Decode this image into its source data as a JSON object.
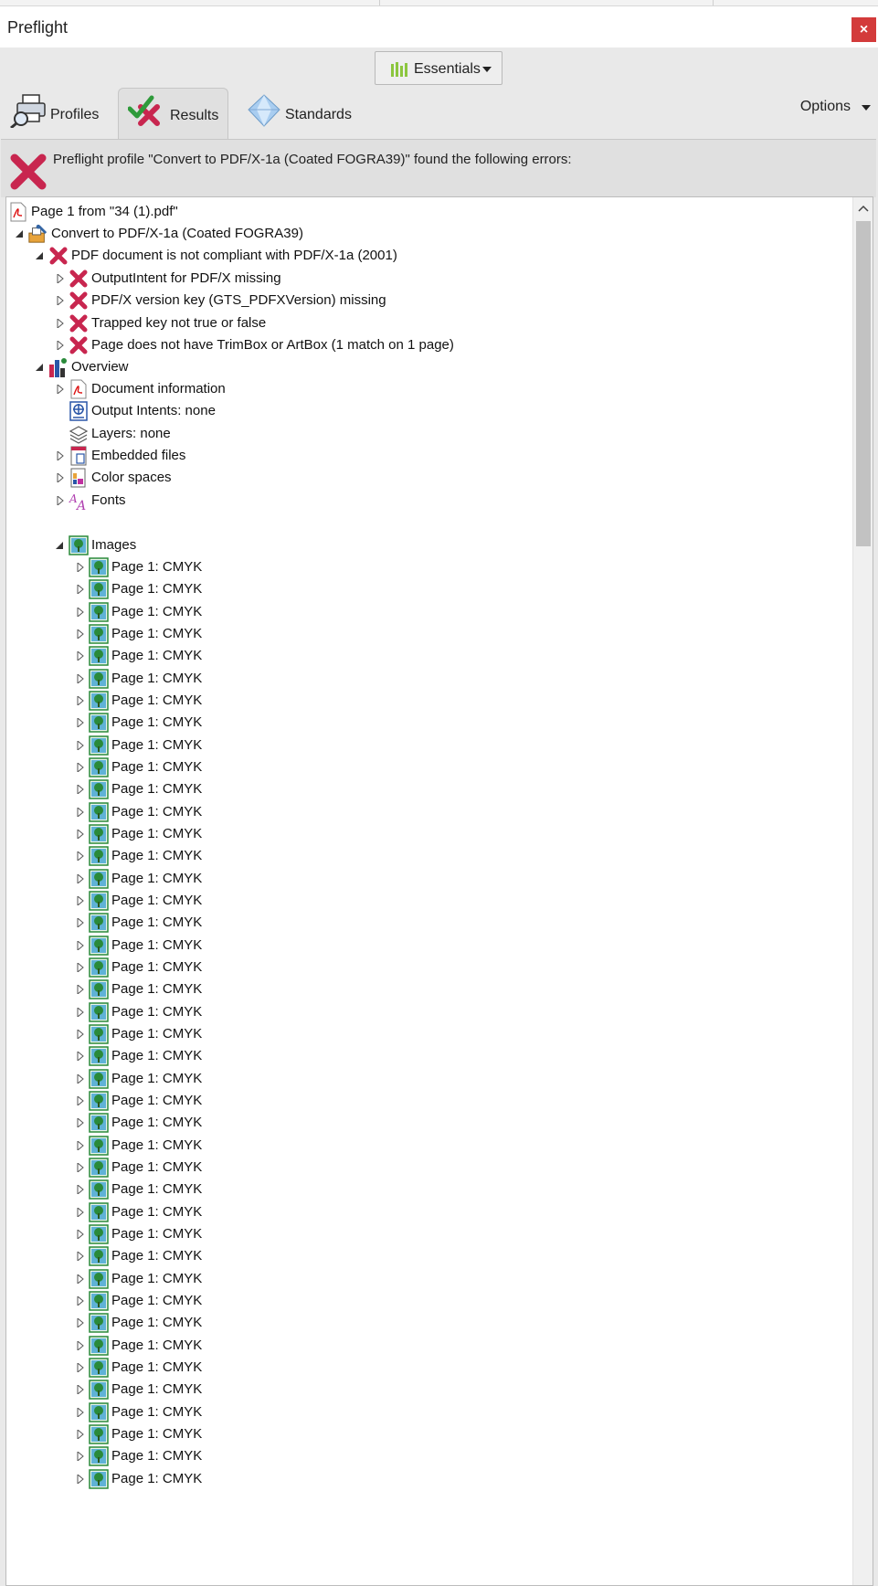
{
  "window": {
    "title": "Preflight",
    "close_label": "×"
  },
  "workspace": {
    "label": "Essentials"
  },
  "tabs": [
    {
      "label": "Profiles"
    },
    {
      "label": "Results"
    },
    {
      "label": "Standards"
    }
  ],
  "options": {
    "label": "Options"
  },
  "banner": {
    "message": "Preflight profile \"Convert to PDF/X-1a (Coated FOGRA39)\" found the following errors:"
  },
  "colors": {
    "error_red": "#c8264f",
    "image_green": "#2a8a3a",
    "accent_lime": "#8cc63f"
  },
  "tree": {
    "root": "Page 1 from \"34 (1).pdf\"",
    "profile": "Convert to PDF/X-1a (Coated FOGRA39)",
    "compliance": "PDF document is not compliant with PDF/X-1a (2001)",
    "errors": [
      "OutputIntent for PDF/X missing",
      "PDF/X version key (GTS_PDFXVersion) missing",
      "Trapped key not true or false",
      "Page does not have TrimBox or ArtBox (1 match on 1 page)"
    ],
    "overview": "Overview",
    "overview_items": [
      {
        "label": "Document information",
        "icon": "pdf-doc-icon",
        "expandable": true
      },
      {
        "label": "Output Intents: none",
        "icon": "output-intent-icon",
        "expandable": false
      },
      {
        "label": "Layers: none",
        "icon": "layers-icon",
        "expandable": false
      },
      {
        "label": "Embedded files",
        "icon": "embedded-file-icon",
        "expandable": true
      },
      {
        "label": "Color spaces",
        "icon": "color-space-icon",
        "expandable": true
      },
      {
        "label": "Fonts",
        "icon": "fonts-icon",
        "expandable": true
      }
    ],
    "images_label": "Images",
    "images": [
      "Page 1: CMYK",
      "Page 1: CMYK",
      "Page 1: CMYK",
      "Page 1: CMYK",
      "Page 1: CMYK",
      "Page 1: CMYK",
      "Page 1: CMYK",
      "Page 1: CMYK",
      "Page 1: CMYK",
      "Page 1: CMYK",
      "Page 1: CMYK",
      "Page 1: CMYK",
      "Page 1: CMYK",
      "Page 1: CMYK",
      "Page 1: CMYK",
      "Page 1: CMYK",
      "Page 1: CMYK",
      "Page 1: CMYK",
      "Page 1: CMYK",
      "Page 1: CMYK",
      "Page 1: CMYK",
      "Page 1: CMYK",
      "Page 1: CMYK",
      "Page 1: CMYK",
      "Page 1: CMYK",
      "Page 1: CMYK",
      "Page 1: CMYK",
      "Page 1: CMYK",
      "Page 1: CMYK",
      "Page 1: CMYK",
      "Page 1: CMYK",
      "Page 1: CMYK",
      "Page 1: CMYK",
      "Page 1: CMYK",
      "Page 1: CMYK",
      "Page 1: CMYK",
      "Page 1: CMYK",
      "Page 1: CMYK",
      "Page 1: CMYK",
      "Page 1: CMYK",
      "Page 1: CMYK",
      "Page 1: CMYK"
    ]
  }
}
